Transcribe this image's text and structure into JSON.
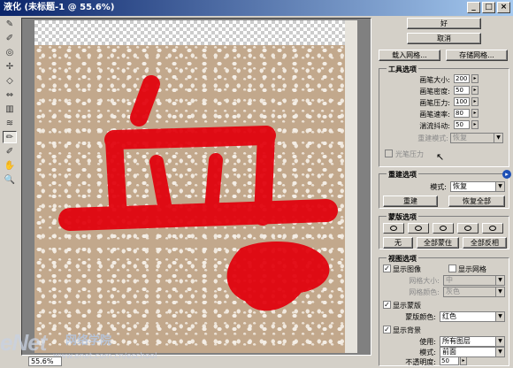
{
  "window": {
    "title": "液化 (未标题-1 @ 55.6%)"
  },
  "titlebar_buttons": [
    "_",
    "□",
    "×"
  ],
  "tools": [
    {
      "name": "forward-warp-icon",
      "glyph": "✎"
    },
    {
      "name": "reconstruct-icon",
      "glyph": "✐"
    },
    {
      "name": "twirl-icon",
      "glyph": "◎"
    },
    {
      "name": "pucker-icon",
      "glyph": "✢"
    },
    {
      "name": "bloat-icon",
      "glyph": "◇"
    },
    {
      "name": "push-left-icon",
      "glyph": "⇔"
    },
    {
      "name": "mirror-icon",
      "glyph": "▥"
    },
    {
      "name": "turbulence-icon",
      "glyph": "≋"
    },
    {
      "name": "freeze-mask-icon",
      "glyph": "✏"
    },
    {
      "name": "thaw-mask-icon",
      "glyph": "✐"
    },
    {
      "name": "hand-icon",
      "glyph": "✋"
    },
    {
      "name": "zoom-icon",
      "glyph": "🔍"
    }
  ],
  "canvas": {
    "glyph": "血",
    "mask_color": "#e2000b"
  },
  "status": {
    "zoom": "55.6%"
  },
  "watermark": {
    "logo": "eNet",
    "cn": "网络学院",
    "url": "www.enet.com.cn/eschool"
  },
  "panel": {
    "ok": "好",
    "cancel": "取消",
    "load_mesh": "载入网格...",
    "save_mesh": "存储网格...",
    "tool_options": {
      "title": "工具选项",
      "fields": [
        {
          "label": "画笔大小:",
          "value": "200"
        },
        {
          "label": "画笔密度:",
          "value": "50"
        },
        {
          "label": "画笔压力:",
          "value": "100"
        },
        {
          "label": "画笔速率:",
          "value": "80"
        },
        {
          "label": "湍流抖动:",
          "value": "50"
        }
      ],
      "reconstruct_mode_label": "重建模式:",
      "reconstruct_mode_value": "恢复",
      "stylus_pressure": "光笔压力"
    },
    "reconstruct_options": {
      "title": "重建选项",
      "mode_label": "模式:",
      "mode_value": "恢复",
      "reconstruct": "重建",
      "restore_all": "恢复全部"
    },
    "mask_options": {
      "title": "蒙版选项",
      "none": "无",
      "mask_all": "全部蒙住",
      "invert_all": "全部反相"
    },
    "view_options": {
      "title": "视图选项",
      "show_image": "显示图像",
      "show_mesh": "显示网格",
      "mesh_size_label": "网格大小:",
      "mesh_size_value": "中",
      "mesh_color_label": "网格颜色:",
      "mesh_color_value": "灰色",
      "show_mask": "显示蒙版",
      "mask_color_label": "蒙版颜色:",
      "mask_color_value": "红色",
      "show_backdrop": "显示背景",
      "use_label": "使用:",
      "use_value": "所有图层",
      "mode_label": "模式:",
      "mode_value": "前面",
      "opacity_label": "不透明度:",
      "opacity_value": "50"
    }
  }
}
